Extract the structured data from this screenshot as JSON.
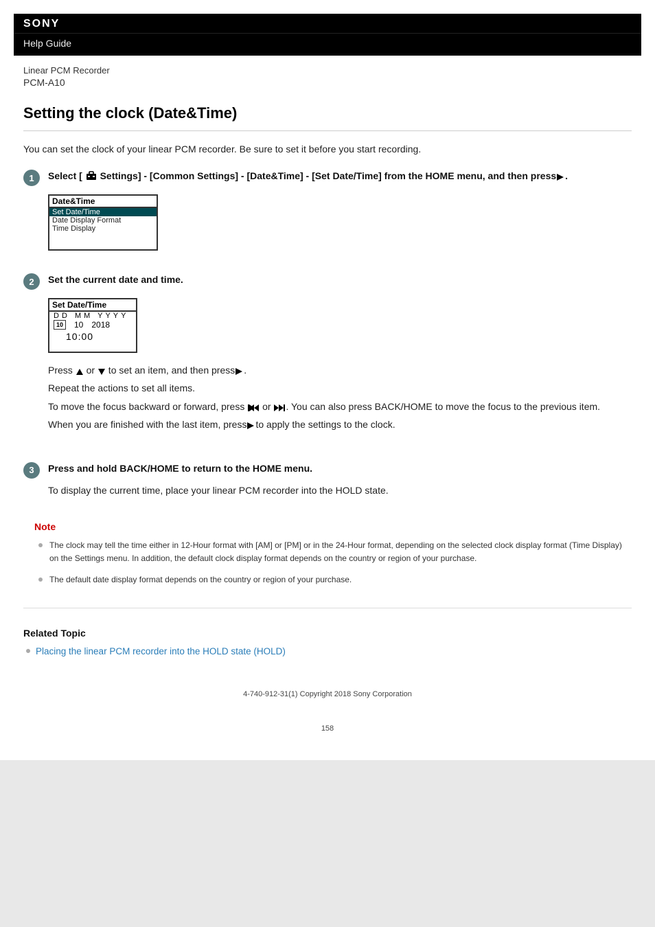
{
  "header": {
    "brand": "SONY",
    "help_guide": "Help Guide",
    "product_line": "Linear PCM Recorder",
    "model": "PCM-A10"
  },
  "title": "Setting the clock (Date&Time)",
  "intro": "You can set the clock of your linear PCM recorder. Be sure to set it before you start recording.",
  "steps": {
    "s1": {
      "num": "1",
      "title_pre": "Select [ ",
      "title_mid": " Settings] - [Common Settings] - [Date&Time] - [Set Date/Time] from the HOME menu, and then press",
      "title_post": ".",
      "lcd": {
        "header": "Date&Time",
        "rows": [
          "Set Date/Time",
          "Date Display Format",
          "Time Display"
        ]
      }
    },
    "s2": {
      "num": "2",
      "title": "Set the current date and time.",
      "lcd": {
        "header": "Set Date/Time",
        "labels": "DD  MM  YYYY",
        "dd": "10",
        "mm": "10",
        "yyyy": "2018",
        "time": "10:00"
      },
      "p1_pre": "Press ",
      "p1_mid": " or ",
      "p1_mid2": " to set an item, and then press",
      "p1_post": ".",
      "p2": "Repeat the actions to set all items.",
      "p3_pre": "To move the focus backward or forward, press ",
      "p3_mid": " or ",
      "p3_post": ". You can also press BACK/HOME to move the focus to the previous item.",
      "p4_pre": "When you are finished with the last item, press",
      "p4_post": "to apply the settings to the clock."
    },
    "s3": {
      "num": "3",
      "title": "Press and hold BACK/HOME to return to the HOME menu.",
      "p1": "To display the current time, place your linear PCM recorder into the HOLD state."
    }
  },
  "note": {
    "heading": "Note",
    "items": [
      "The clock may tell the time either in 12-Hour format with [AM] or [PM] or in the 24-Hour format, depending on the selected clock display format (Time Display) on the Settings menu. In addition, the default clock display format depends on the country or region of your purchase.",
      "The default date display format depends on the country or region of your purchase."
    ]
  },
  "related": {
    "heading": "Related Topic",
    "link": "Placing the linear PCM recorder into the HOLD state (HOLD)"
  },
  "copyright": "4-740-912-31(1) Copyright 2018 Sony Corporation",
  "page_number": "158"
}
